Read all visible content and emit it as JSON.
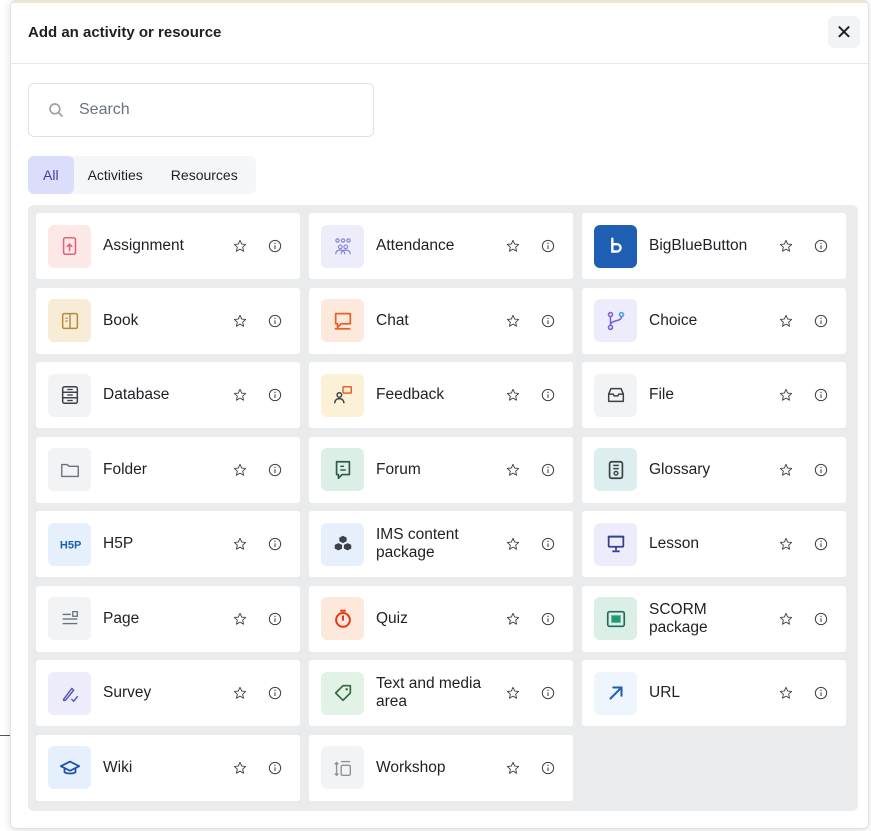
{
  "modal": {
    "title": "Add an activity or resource",
    "close_label": "✕"
  },
  "search": {
    "placeholder": "Search",
    "value": ""
  },
  "tabs": [
    {
      "label": "All",
      "active": true
    },
    {
      "label": "Activities",
      "active": false
    },
    {
      "label": "Resources",
      "active": false
    }
  ],
  "items": [
    {
      "name": "Assignment",
      "icon": "assignment-icon",
      "bg": "#fde8e8",
      "fg": "#e0637a"
    },
    {
      "name": "Attendance",
      "icon": "attendance-icon",
      "bg": "#ececfb",
      "fg": "#8a86d8"
    },
    {
      "name": "BigBlueButton",
      "icon": "bigbluebutton-icon",
      "bg": "#1e5fb4",
      "fg": "#ffffff"
    },
    {
      "name": "Book",
      "icon": "book-icon",
      "bg": "#f7ecd5",
      "fg": "#b68a3e"
    },
    {
      "name": "Chat",
      "icon": "chat-icon",
      "bg": "#fde9dc",
      "fg": "#e4622a"
    },
    {
      "name": "Choice",
      "icon": "choice-icon",
      "bg": "#ececfb",
      "fg": "#7b62d8"
    },
    {
      "name": "Database",
      "icon": "database-icon",
      "bg": "#f1f3f5",
      "fg": "#3b4147"
    },
    {
      "name": "Feedback",
      "icon": "feedback-icon",
      "bg": "#fbf1d6",
      "fg": "#e4622a"
    },
    {
      "name": "File",
      "icon": "file-icon",
      "bg": "#f1f3f5",
      "fg": "#3b4147"
    },
    {
      "name": "Folder",
      "icon": "folder-icon",
      "bg": "#f1f3f5",
      "fg": "#6a737b"
    },
    {
      "name": "Forum",
      "icon": "forum-icon",
      "bg": "#dcefe7",
      "fg": "#2d5a48"
    },
    {
      "name": "Glossary",
      "icon": "glossary-icon",
      "bg": "#dcefee",
      "fg": "#3b4147"
    },
    {
      "name": "H5P",
      "icon": "h5p-icon",
      "bg": "#e6f0fd",
      "fg": "#1e5fb4"
    },
    {
      "name": "IMS content package",
      "icon": "ims-package-icon",
      "bg": "#e6f0fd",
      "fg": "#3b4147"
    },
    {
      "name": "Lesson",
      "icon": "lesson-icon",
      "bg": "#ececfb",
      "fg": "#3b3f8a"
    },
    {
      "name": "Page",
      "icon": "page-icon",
      "bg": "#f1f3f5",
      "fg": "#6a737b"
    },
    {
      "name": "Quiz",
      "icon": "quiz-icon",
      "bg": "#fde9dc",
      "fg": "#e43a1a"
    },
    {
      "name": "SCORM package",
      "icon": "scorm-icon",
      "bg": "#dcefe7",
      "fg": "#1e6b5a"
    },
    {
      "name": "Survey",
      "icon": "survey-icon",
      "bg": "#ececfb",
      "fg": "#5b57b8"
    },
    {
      "name": "Text and media area",
      "icon": "text-media-icon",
      "bg": "#e2f2e6",
      "fg": "#2d6a3e"
    },
    {
      "name": "URL",
      "icon": "url-icon",
      "bg": "#eef5fd",
      "fg": "#1e5fb4"
    },
    {
      "name": "Wiki",
      "icon": "wiki-icon",
      "bg": "#e6f0fd",
      "fg": "#1e4fa8"
    },
    {
      "name": "Workshop",
      "icon": "workshop-icon",
      "bg": "#f1f3f5",
      "fg": "#8a9198"
    }
  ]
}
